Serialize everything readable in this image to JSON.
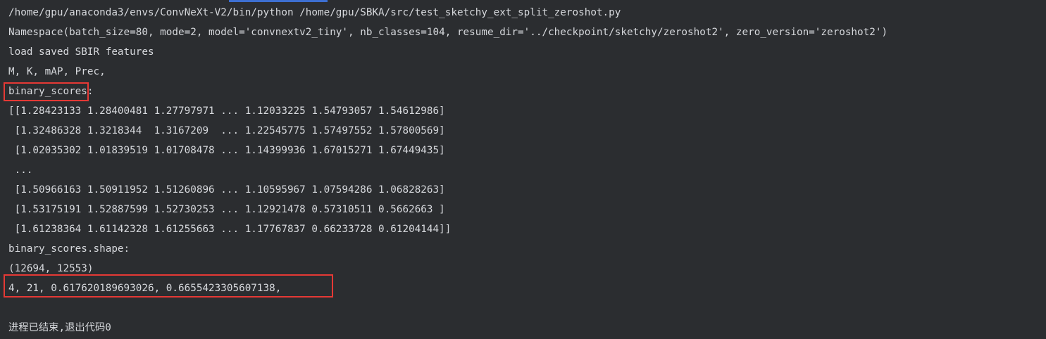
{
  "console": {
    "command": "/home/gpu/anaconda3/envs/ConvNeXt-V2/bin/python /home/gpu/SBKA/src/test_sketchy_ext_split_zeroshot.py",
    "namespace": "Namespace(batch_size=80, mode=2, model='convnextv2_tiny', nb_classes=104, resume_dir='../checkpoint/sketchy/zeroshot2', zero_version='zeroshot2')",
    "load_msg": "load saved SBIR features",
    "metrics_header": "M, K, mAP, Prec,",
    "binary_scores_label": "binary_scores:",
    "matrix_rows": [
      "[[1.28423133 1.28400481 1.27797971 ... 1.12033225 1.54793057 1.54612986]",
      " [1.32486328 1.3218344  1.3167209  ... 1.22545775 1.57497552 1.57800569]",
      " [1.02035302 1.01839519 1.01708478 ... 1.14399936 1.67015271 1.67449435]",
      " ...",
      " [1.50966163 1.50911952 1.51260896 ... 1.10595967 1.07594286 1.06828263]",
      " [1.53175191 1.52887599 1.52730253 ... 1.12921478 0.57310511 0.5662663 ]",
      " [1.61238364 1.61142328 1.61255663 ... 1.17767837 0.66233728 0.61204144]]"
    ],
    "shape_label": "binary_scores.shape:",
    "shape_value": "(12694, 12553)",
    "metrics_result": "4, 21, 0.617620189693026, 0.6655423305607138,",
    "exit_msg": "进程已结束,退出代码0"
  },
  "colors": {
    "background": "#2b2d30",
    "text": "#d6d8dc",
    "highlight_box": "#e53935",
    "tab_accent": "#3d6fd1"
  }
}
